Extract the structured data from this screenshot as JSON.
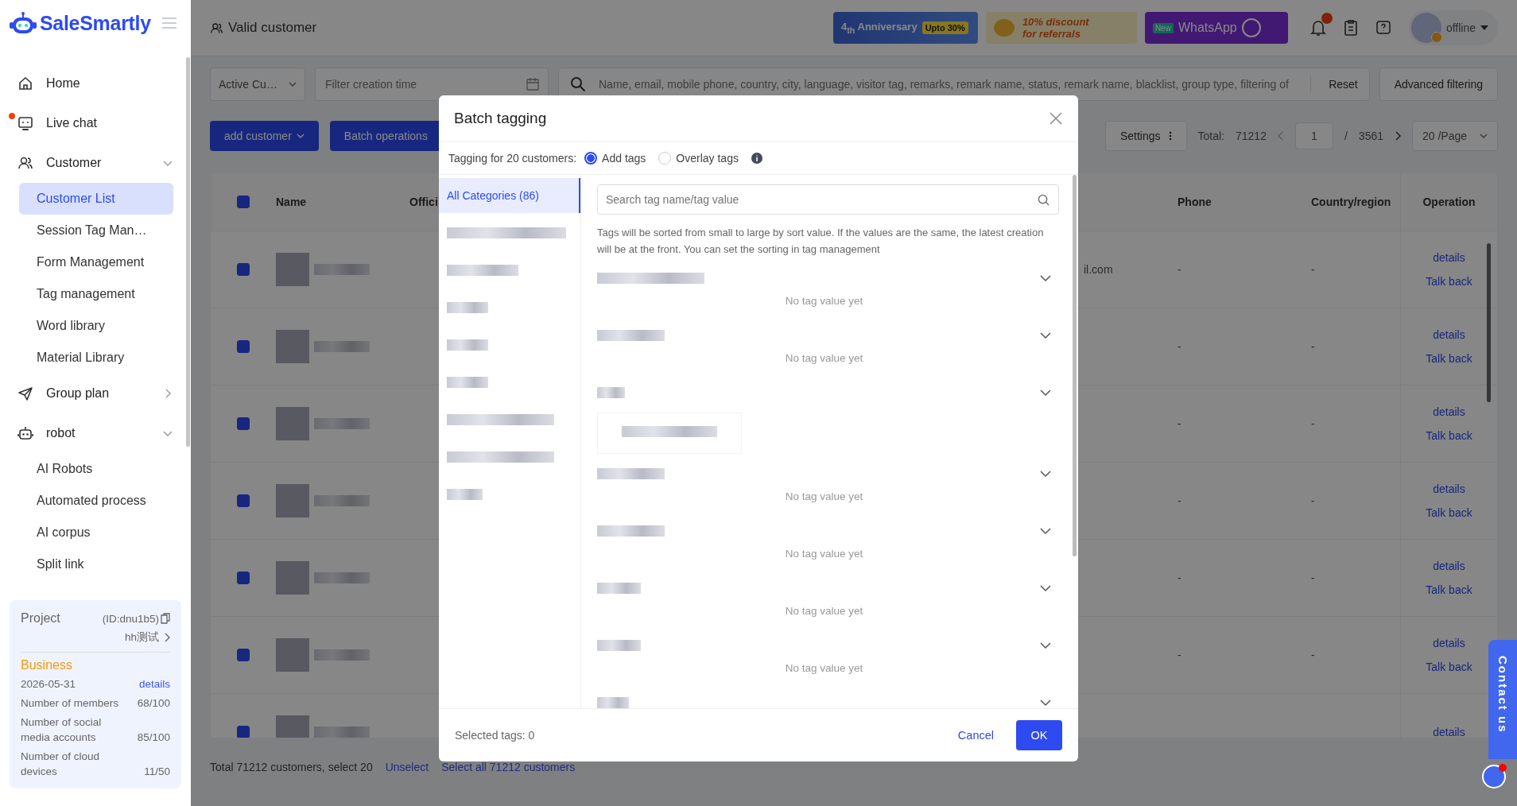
{
  "sidebar": {
    "logo": "SaleSmartly",
    "items": [
      {
        "label": "Home",
        "selected": false,
        "dot": false
      },
      {
        "label": "Live chat",
        "selected": false,
        "dot": true
      },
      {
        "label": "Customer",
        "selected": false,
        "dot": false,
        "expanded": true,
        "children": [
          {
            "label": "Customer List",
            "selected": true
          },
          {
            "label": "Session Tag Man…",
            "selected": false
          },
          {
            "label": "Form Management",
            "selected": false
          },
          {
            "label": "Tag management",
            "selected": false
          },
          {
            "label": "Word library",
            "selected": false
          },
          {
            "label": "Material Library",
            "selected": false
          }
        ]
      },
      {
        "label": "Group plan",
        "selected": false,
        "dot": false,
        "expanded": false
      },
      {
        "label": "robot",
        "selected": false,
        "dot": false,
        "expanded": true,
        "children": [
          {
            "label": "AI Robots",
            "selected": false
          },
          {
            "label": "Automated process",
            "selected": false
          },
          {
            "label": "AI corpus",
            "selected": false
          },
          {
            "label": "Split link",
            "selected": false
          }
        ]
      }
    ]
  },
  "project": {
    "label": "Project",
    "id": "(ID:dnu1b5)",
    "name": "hh测试",
    "plan": "Business",
    "expiry": "2026-05-31",
    "details_link": "details",
    "quotas": [
      {
        "label": "Number of members",
        "value": "68/100"
      },
      {
        "label": "Number of social media accounts",
        "value": "85/100"
      },
      {
        "label": "Number of cloud devices",
        "value": "11/50"
      }
    ]
  },
  "topbar": {
    "title": "Valid customer",
    "banners": [
      {
        "kind": "anniversary",
        "text": "4$_{th}$ Anniversary",
        "badge": "Upto 30%"
      },
      {
        "kind": "referral",
        "text": "10% discount",
        "badge": "for referrals"
      },
      {
        "kind": "whatsapp",
        "text": "WhatsApp",
        "badge": "New"
      }
    ],
    "notification_dot": true,
    "user_status": "offline"
  },
  "filters": {
    "status_select": "Active Cu…",
    "date_placeholder": "Filter creation time",
    "search_placeholder": "Name, email, mobile phone, country, city, language, visitor tag, remarks, remark name, status, remark name, blacklist, group type, filtering of",
    "reset": "Reset",
    "advanced": "Advanced filtering"
  },
  "actions": {
    "add": "add customer",
    "batch": "Batch operations",
    "settings": "Settings",
    "total_label": "Total:",
    "total": "71212",
    "page": "1",
    "page_sep": "/",
    "pages": "3561",
    "page_size": "20 /Page"
  },
  "table": {
    "all_checked": true,
    "columns": [
      "Name",
      "Offici",
      "Phone",
      "Country/region",
      "Operation"
    ],
    "rows": [
      {
        "checked": true,
        "email": "il.com",
        "phone": "-",
        "country": "-",
        "operations": [
          "details",
          "Talk back"
        ]
      },
      {
        "checked": true,
        "phone": "-",
        "country": "-",
        "operations": [
          "details",
          "Talk back"
        ]
      },
      {
        "checked": true,
        "phone": "-",
        "country": "-",
        "operations": [
          "details",
          "Talk back"
        ]
      },
      {
        "checked": true,
        "phone": "-",
        "country": "-",
        "operations": [
          "details",
          "Talk back"
        ]
      },
      {
        "checked": true,
        "phone": "-",
        "country": "-",
        "operations": [
          "details",
          "Talk back"
        ]
      },
      {
        "checked": true,
        "phone": "-",
        "country": "-",
        "operations": [
          "details",
          "Talk back"
        ]
      },
      {
        "checked": true,
        "operations": [
          "details"
        ]
      }
    ]
  },
  "footer": {
    "summary": "Total 71212 customers, select 20",
    "unselect": "Unselect",
    "select_all": "Select all 71212 customers"
  },
  "modal": {
    "title": "Batch tagging",
    "mode_label": "Tagging for 20 customers:",
    "modes": [
      {
        "label": "Add tags",
        "selected": true
      },
      {
        "label": "Overlay tags",
        "selected": false
      }
    ],
    "categories": [
      {
        "label": "All Categories (86)",
        "selected": true
      },
      {
        "selected": false
      },
      {
        "selected": false
      },
      {
        "selected": false
      },
      {
        "selected": false
      },
      {
        "selected": false
      },
      {
        "selected": false
      },
      {
        "selected": false
      },
      {
        "selected": false
      }
    ],
    "search_placeholder": "Search tag name/tag value",
    "note": "Tags will be sorted from small to large by sort value. If the values are the same, the latest creation will be at the front. You can set the sorting in tag management",
    "tag_groups": [
      {
        "kind": "empty",
        "note": "No tag value yet"
      },
      {
        "kind": "empty",
        "note": "No tag value yet"
      },
      {
        "kind": "values"
      },
      {
        "kind": "empty",
        "note": "No tag value yet"
      },
      {
        "kind": "empty",
        "note": "No tag value yet"
      },
      {
        "kind": "empty",
        "note": "No tag value yet"
      },
      {
        "kind": "empty",
        "note": "No tag value yet"
      },
      {
        "kind": "partial"
      }
    ],
    "selected_count": "Selected tags: 0",
    "cancel": "Cancel",
    "ok": "OK"
  },
  "contact": "Contact us"
}
